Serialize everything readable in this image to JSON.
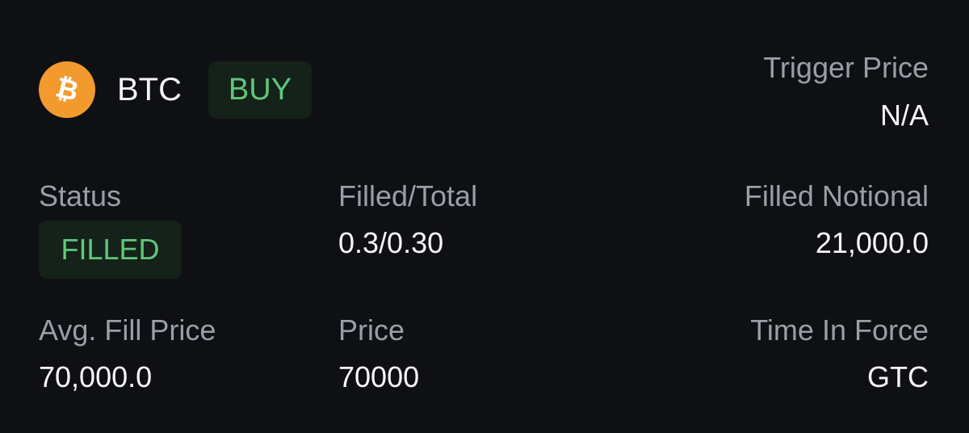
{
  "order": {
    "symbol": "BTC",
    "coin_icon": "bitcoin-icon",
    "side": "BUY",
    "trigger_price": {
      "label": "Trigger Price",
      "value": "N/A"
    },
    "status": {
      "label": "Status",
      "value": "FILLED"
    },
    "filled_total": {
      "label": "Filled/Total",
      "value": "0.3/0.30"
    },
    "filled_notional": {
      "label": "Filled Notional",
      "value": "21,000.0"
    },
    "avg_fill_price": {
      "label": "Avg. Fill Price",
      "value": "70,000.0"
    },
    "price": {
      "label": "Price",
      "value": "70000"
    },
    "time_in_force": {
      "label": "Time In Force",
      "value": "GTC"
    }
  },
  "colors": {
    "background": "#0f1014",
    "label": "#9a9ea8",
    "value": "#f5f6f8",
    "buy_green": "#5fc77b",
    "badge_bg": "#142219",
    "bitcoin_orange": "#f39a2f"
  }
}
